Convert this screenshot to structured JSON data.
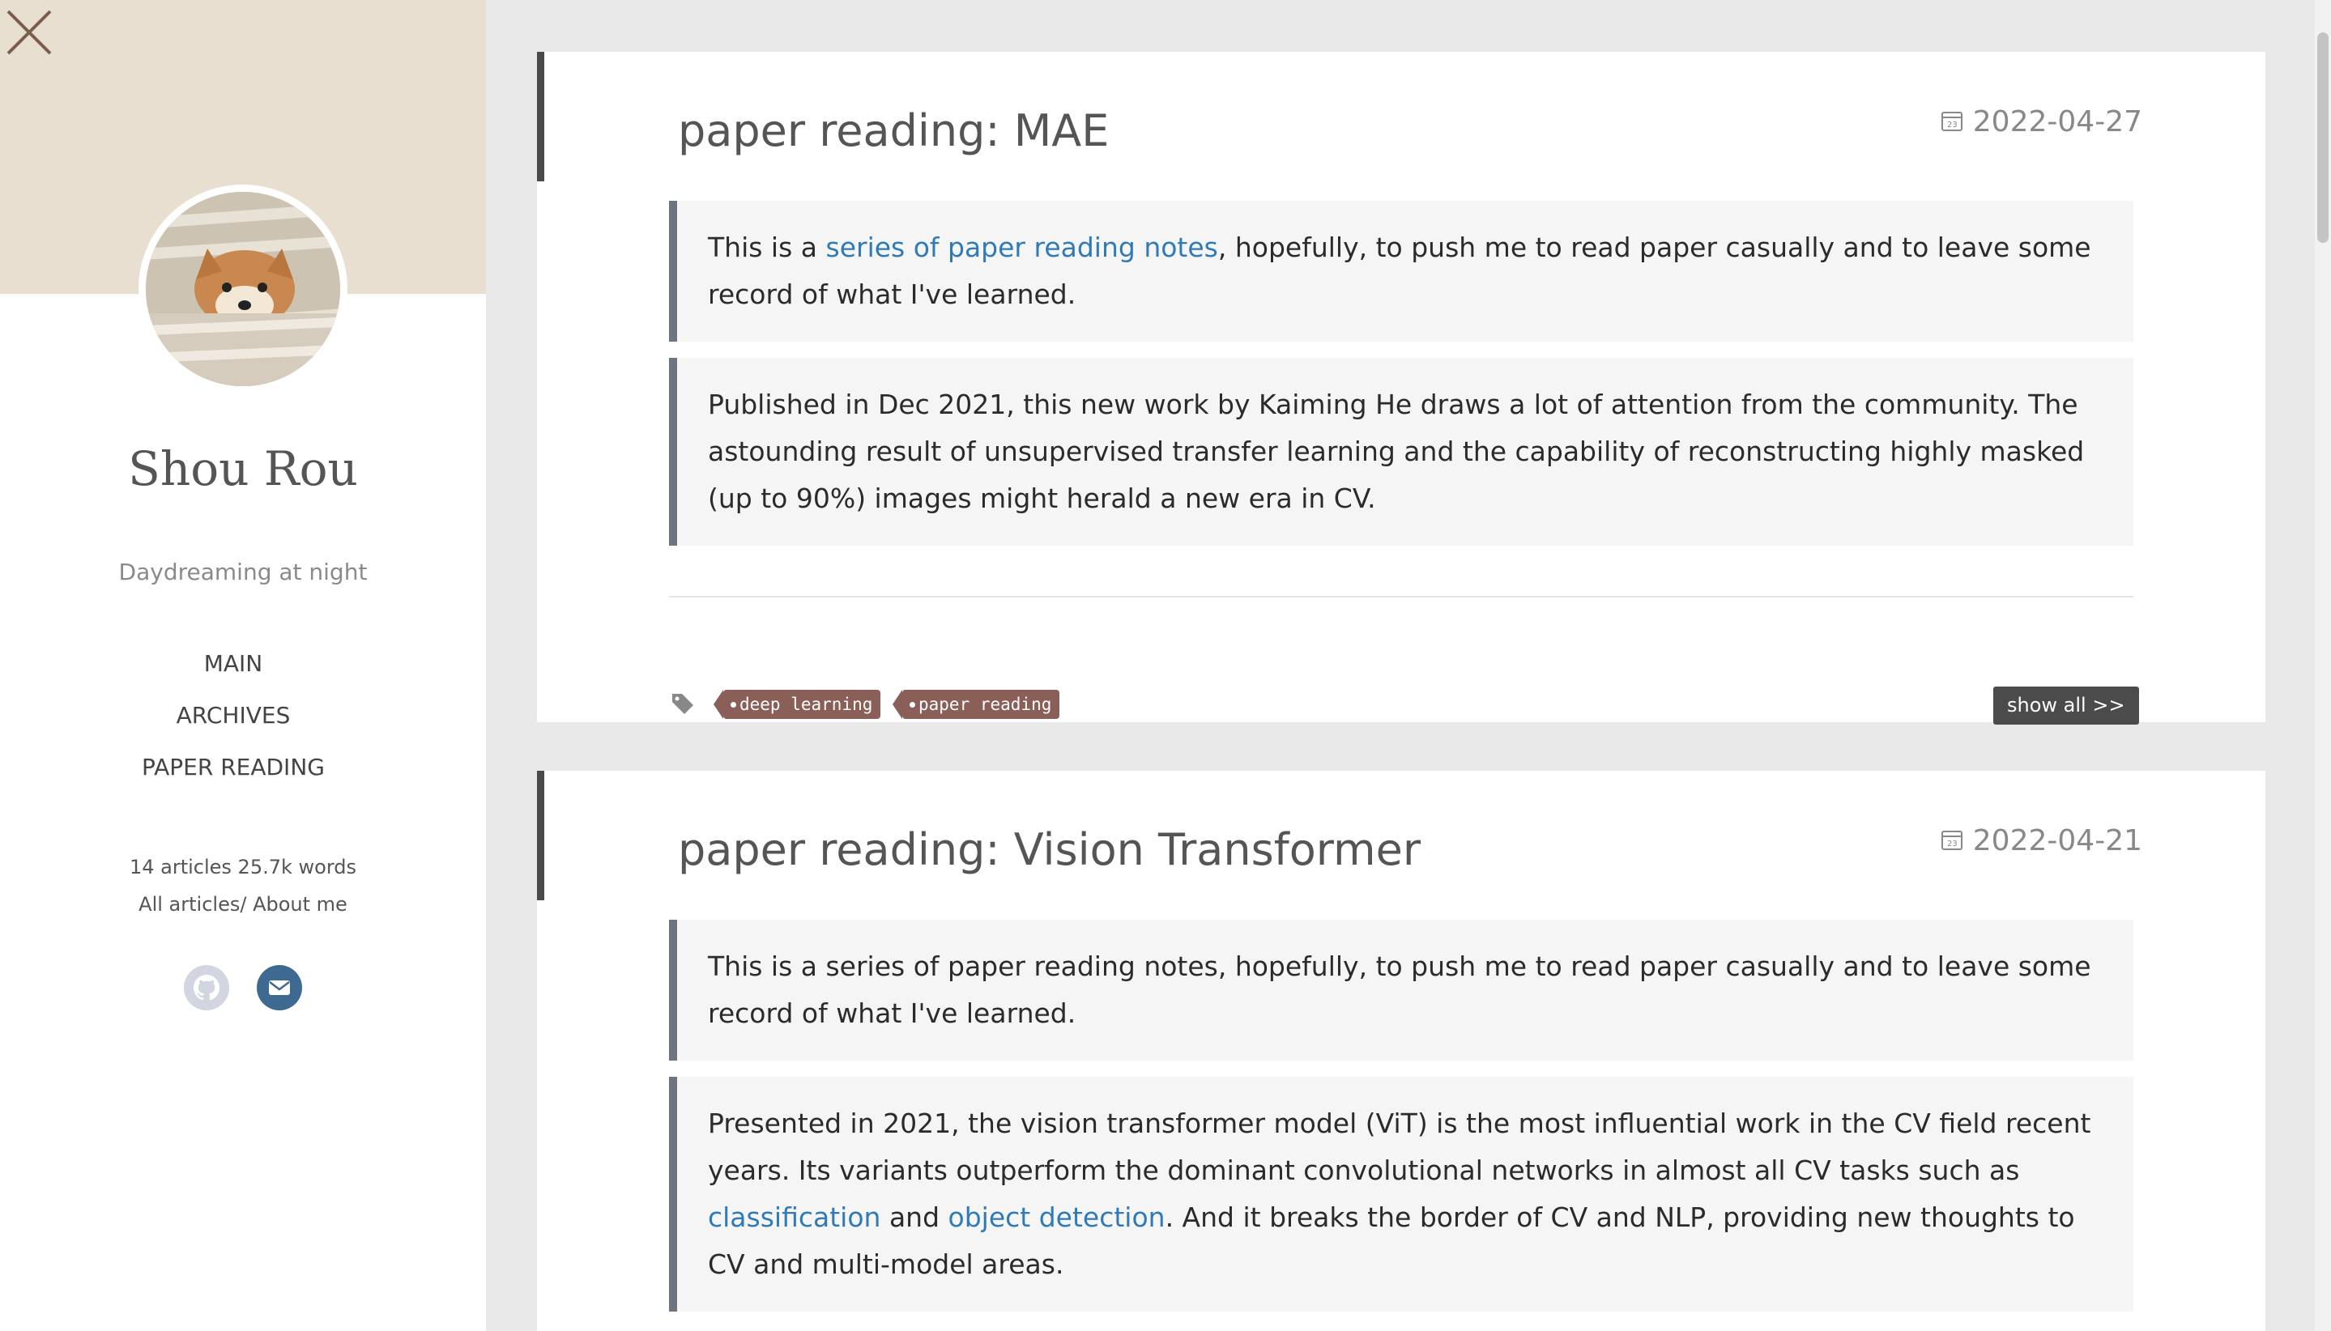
{
  "sidebar": {
    "profile": {
      "name": "Shou Rou",
      "motto": "Daydreaming at night"
    },
    "nav": [
      {
        "label": "MAIN"
      },
      {
        "label": "ARCHIVES"
      },
      {
        "label": "PAPER READING"
      }
    ],
    "stats": {
      "summary": "14 articles 25.7k words",
      "all_articles": "All articles/",
      "about_me": "About me"
    },
    "socials": [
      "github-icon",
      "mail-icon"
    ]
  },
  "posts": [
    {
      "title": "paper reading: MAE",
      "date": "2022-04-27",
      "intro": {
        "before": "This is a ",
        "link": "series of paper reading notes",
        "after": ", hopefully, to push me to read paper casually and to leave some record of what I've learned."
      },
      "summary": "Published in Dec 2021, this new work by Kaiming He draws a lot of attention from the community. The astounding result of unsupervised transfer learning and the capability of reconstructing highly masked (up to 90%) images might herald a new era in CV.",
      "tags": [
        "deep learning",
        "paper reading"
      ],
      "show_all": "show all >>"
    },
    {
      "title": "paper reading: Vision Transformer",
      "date": "2022-04-21",
      "intro": "This is a series of paper reading notes, hopefully, to push me to read paper casually and to leave some record of what I've learned.",
      "summary": {
        "part1": "Presented in 2021, the vision transformer model (ViT) is the most influential work in the CV field recent years. Its variants outperform the dominant convolutional networks in almost all CV tasks such as ",
        "link1": "classification",
        "part2": " and ",
        "link2": "object detection",
        "part3": ". And it breaks the border of CV and NLP, providing new thoughts to CV and multi-model areas."
      }
    }
  ],
  "colors": {
    "banner": "#e8dfd1",
    "tag": "#8a5f58",
    "link": "#2f7ab8",
    "quote_border": "#6c757d"
  }
}
